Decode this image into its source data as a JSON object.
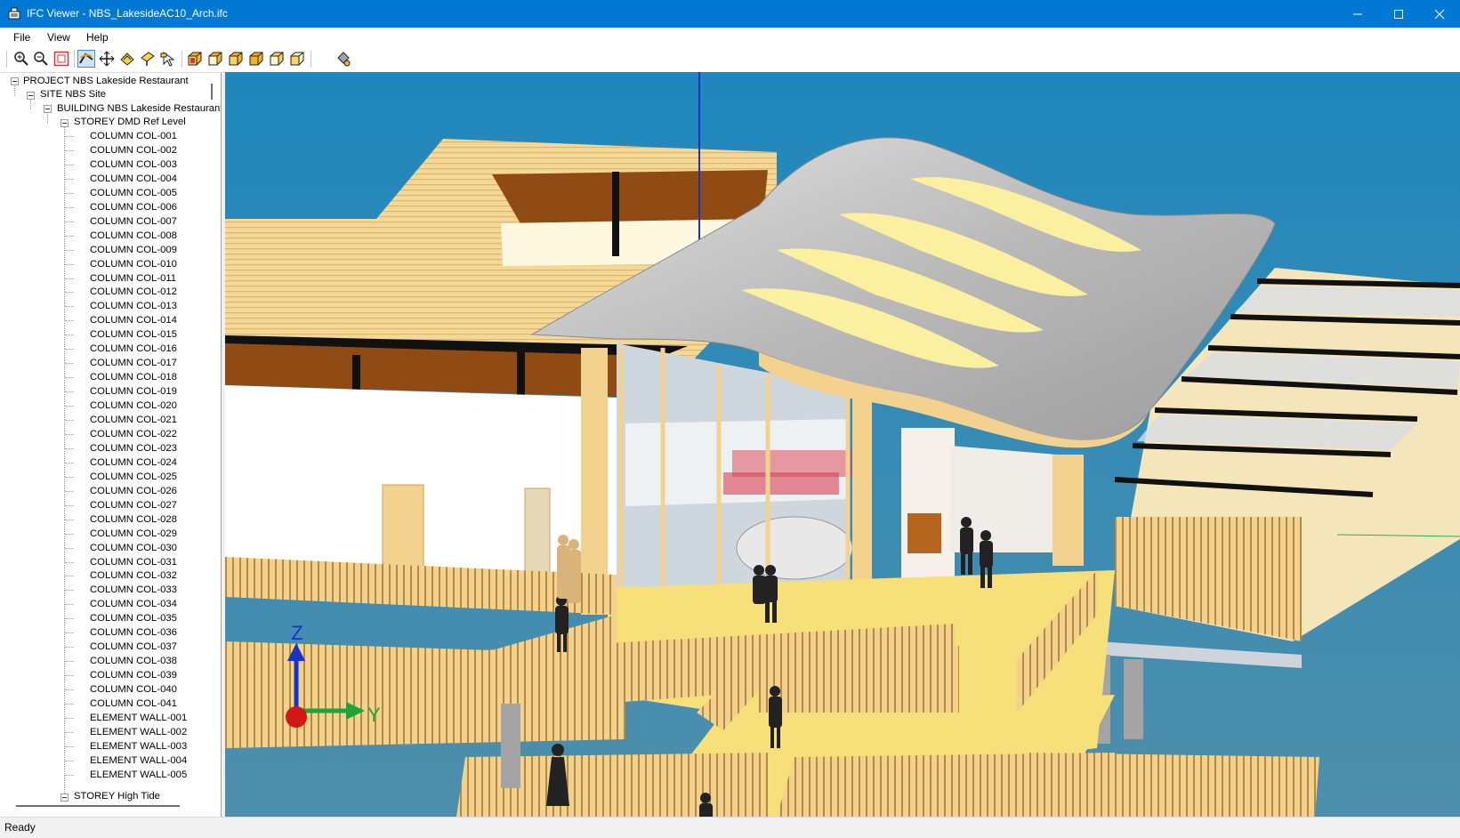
{
  "window": {
    "title": "IFC Viewer - NBS_LakesideAC10_Arch.ifc",
    "buttons": [
      "minimize-icon",
      "maximize-icon",
      "close-icon"
    ]
  },
  "menu": {
    "items": [
      "File",
      "View",
      "Help"
    ]
  },
  "toolbar": {
    "buttons": [
      {
        "name": "zoom-in-icon"
      },
      {
        "name": "zoom-out-icon"
      },
      {
        "name": "zoom-extents-icon"
      },
      {
        "name": "orbit-icon",
        "active": true
      },
      {
        "name": "pan-icon"
      },
      {
        "name": "walk-icon"
      },
      {
        "name": "fly-icon"
      },
      {
        "name": "select-icon"
      },
      {
        "name": "view-front-icon"
      },
      {
        "name": "view-back-icon"
      },
      {
        "name": "view-left-icon"
      },
      {
        "name": "view-right-icon"
      },
      {
        "name": "view-top-icon"
      },
      {
        "name": "view-bottom-icon"
      },
      {
        "name": "render-mode-icon"
      }
    ]
  },
  "tree": {
    "project": "PROJECT NBS Lakeside Restaurant",
    "site": "SITE NBS Site",
    "building": "BUILDING NBS Lakeside Restaurant",
    "storey1": "STOREY DMD Ref Level",
    "elements": [
      "COLUMN COL-001",
      "COLUMN COL-002",
      "COLUMN COL-003",
      "COLUMN COL-004",
      "COLUMN COL-005",
      "COLUMN COL-006",
      "COLUMN COL-007",
      "COLUMN COL-008",
      "COLUMN COL-009",
      "COLUMN COL-010",
      "COLUMN COL-011",
      "COLUMN COL-012",
      "COLUMN COL-013",
      "COLUMN COL-014",
      "COLUMN COL-015",
      "COLUMN COL-016",
      "COLUMN COL-017",
      "COLUMN COL-018",
      "COLUMN COL-019",
      "COLUMN COL-020",
      "COLUMN COL-021",
      "COLUMN COL-022",
      "COLUMN COL-023",
      "COLUMN COL-024",
      "COLUMN COL-025",
      "COLUMN COL-026",
      "COLUMN COL-027",
      "COLUMN COL-028",
      "COLUMN COL-029",
      "COLUMN COL-030",
      "COLUMN COL-031",
      "COLUMN COL-032",
      "COLUMN COL-033",
      "COLUMN COL-034",
      "COLUMN COL-035",
      "COLUMN COL-036",
      "COLUMN COL-037",
      "COLUMN COL-038",
      "COLUMN COL-039",
      "COLUMN COL-040",
      "COLUMN COL-041",
      "ELEMENT WALL-001",
      "ELEMENT WALL-002",
      "ELEMENT WALL-003",
      "ELEMENT WALL-004",
      "ELEMENT WALL-005"
    ],
    "storey2": "STOREY High Tide"
  },
  "viewport": {
    "axis_labels": {
      "z": "Z",
      "y": "Y"
    },
    "colors": {
      "sky_top": "#1f87bd",
      "sky_bottom": "#4f8fab",
      "roof": "#c4c4c4",
      "timber": "#f2d28e",
      "deck": "#f7e07a",
      "accent_titlebar": "#0178d4"
    }
  },
  "status": {
    "text": "Ready"
  }
}
